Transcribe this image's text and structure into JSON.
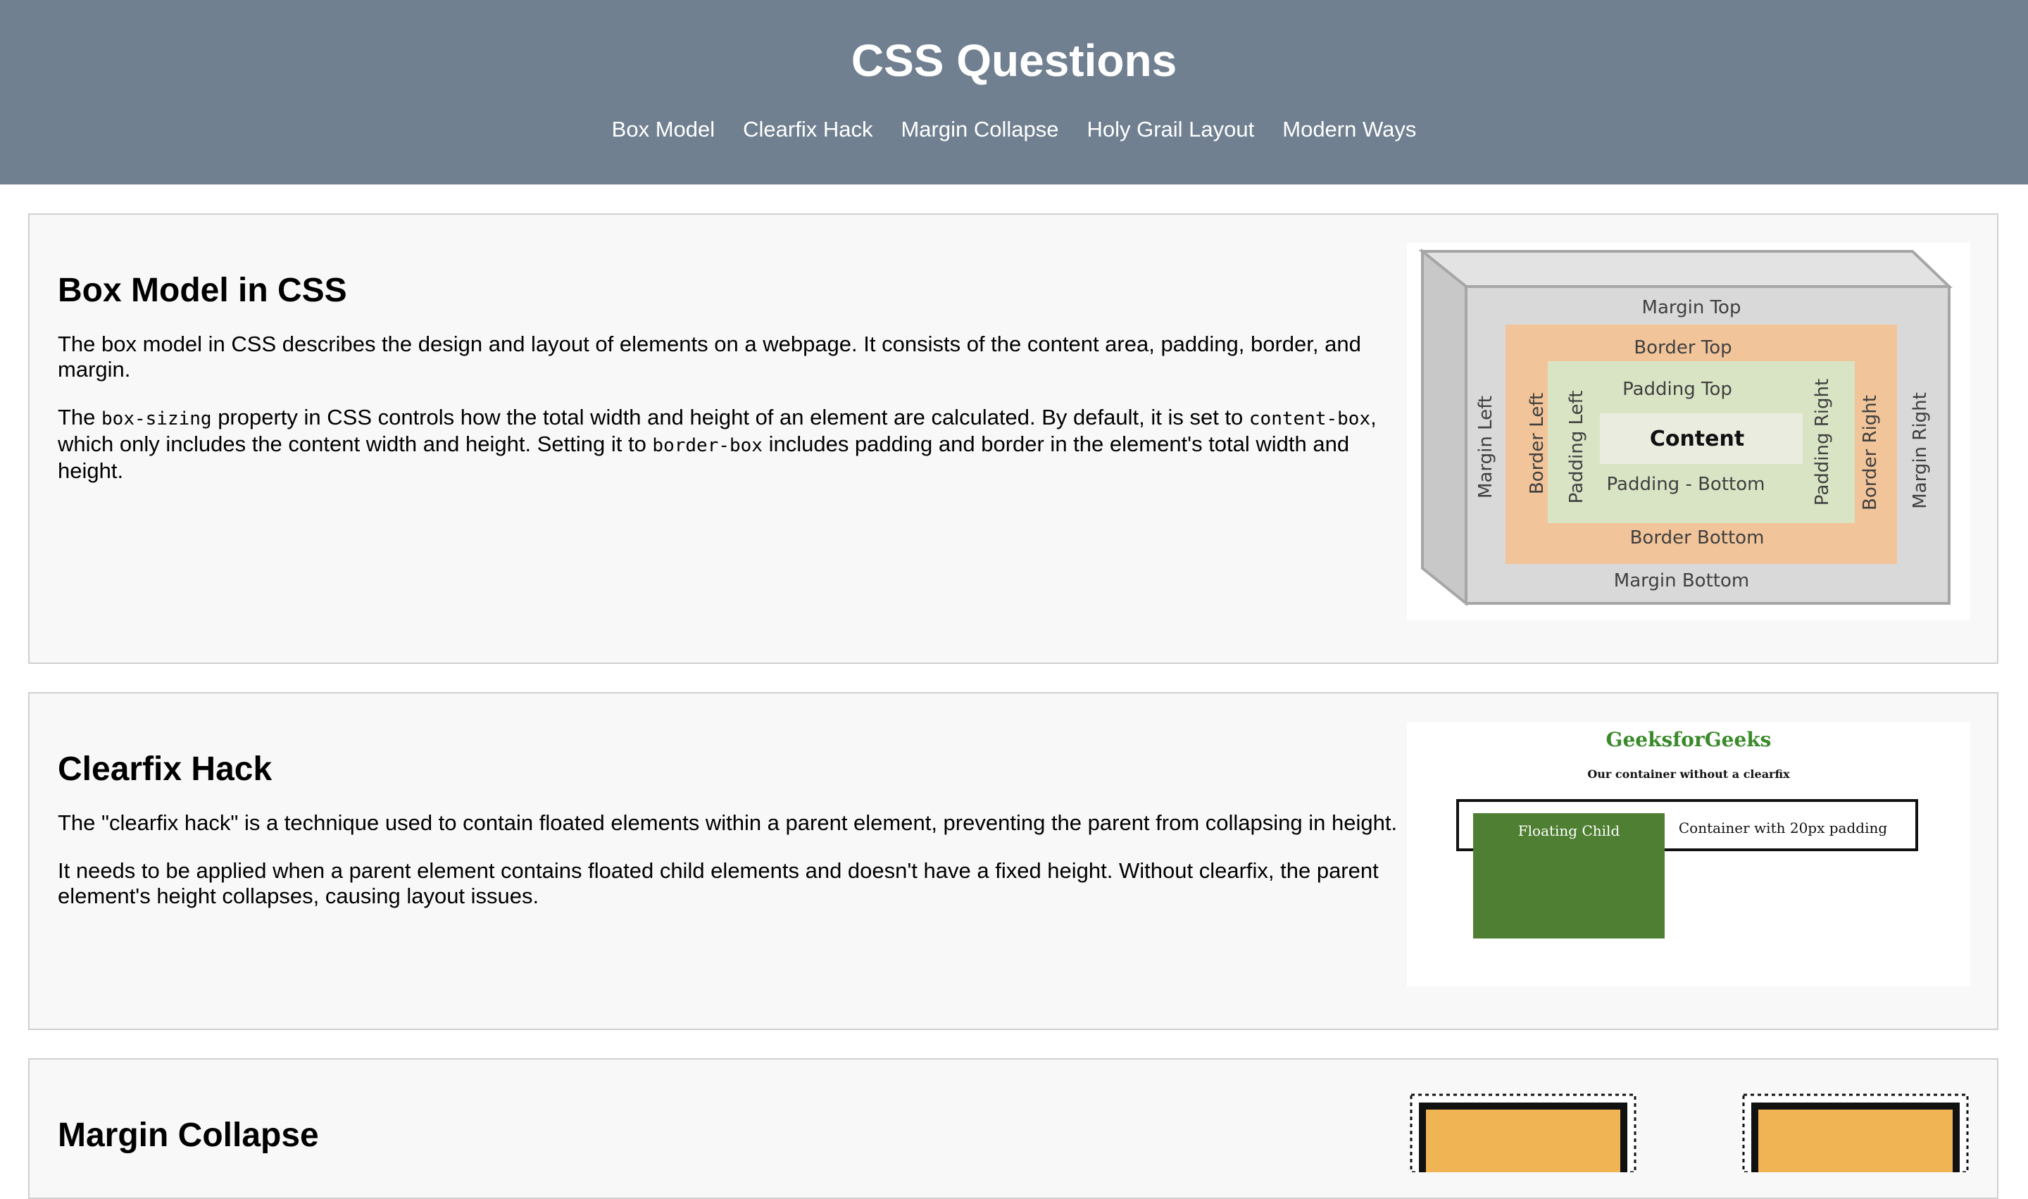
{
  "header": {
    "title": "CSS Questions",
    "nav": [
      "Box Model",
      "Clearfix Hack",
      "Margin Collapse",
      "Holy Grail Layout",
      "Modern Ways"
    ]
  },
  "sections": [
    {
      "title": "Box Model in CSS",
      "p1": "The box model in CSS describes the design and layout of elements on a webpage. It consists of the content area, padding, border, and margin.",
      "p2": {
        "t1": "The ",
        "c1": "box-sizing",
        "t2": " property in CSS controls how the total width and height of an element are calculated. By default, it is set to ",
        "c2": "content-box",
        "t3": ", which only includes the content width and height. Setting it to ",
        "c3": "border-box",
        "t4": " includes padding and border in the element's total width and height."
      },
      "figure": {
        "margin_top": "Margin Top",
        "margin_bottom": "Margin Bottom",
        "margin_left": "Margin Left",
        "margin_right": "Margin Right",
        "border_top": "Border Top",
        "border_bottom": "Border Bottom",
        "border_left": "Border Left",
        "border_right": "Border Right",
        "padding_top": "Padding Top",
        "padding_bottom": "Padding - Bottom",
        "padding_left": "Padding Left",
        "padding_right": "Padding Right",
        "content": "Content",
        "colors": {
          "margin": "#d9d9d9",
          "border": "#f2c499",
          "padding": "#d9e4c4",
          "content": "#ebece0"
        }
      }
    },
    {
      "title": "Clearfix Hack",
      "p1": "The \"clearfix hack\" is a technique used to contain floated elements within a parent element, preventing the parent from collapsing in height.",
      "p2": "It needs to be applied when a parent element contains floated child elements and doesn't have a fixed height. Without clearfix, the parent element's height collapses, causing layout issues.",
      "figure": {
        "brand": "GeeksforGeeks",
        "subtitle": "Our container without a clearfix",
        "container_label": "Container with 20px padding",
        "child_label": "Floating Child",
        "colors": {
          "brand": "#3a8a2a",
          "child": "#4e7f32"
        }
      }
    },
    {
      "title": "Margin Collapse",
      "figure": {
        "colors": {
          "box": "#f0b454"
        }
      }
    }
  ]
}
